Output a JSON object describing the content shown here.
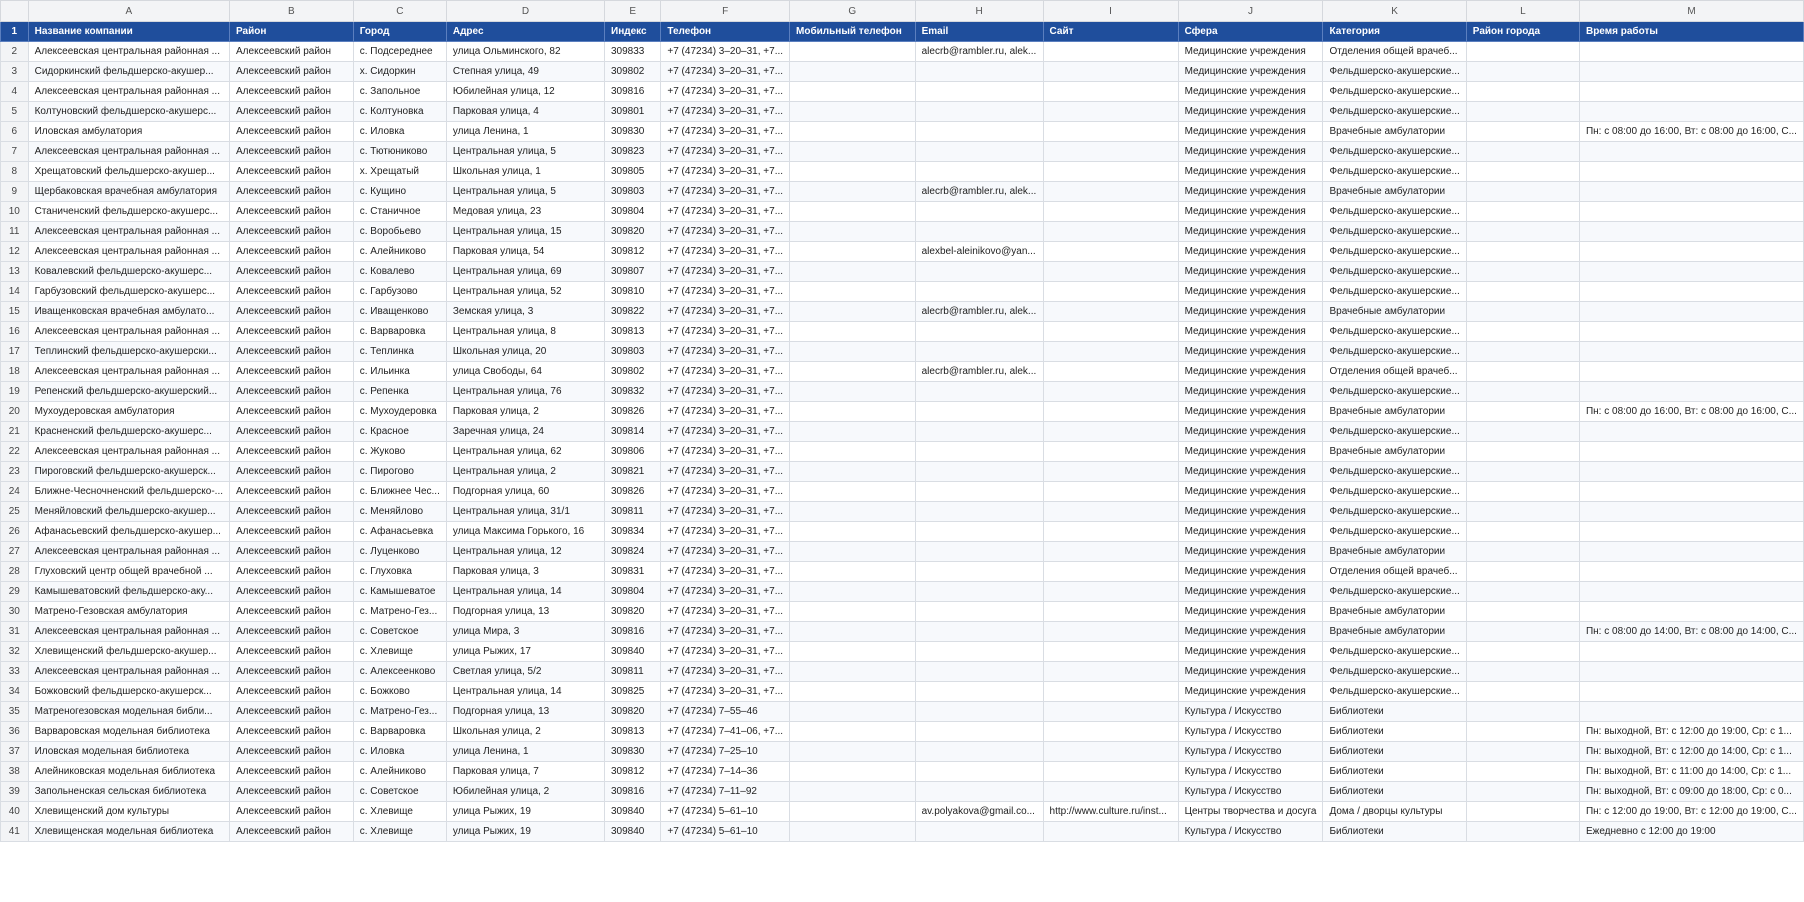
{
  "column_letters": [
    "A",
    "B",
    "C",
    "D",
    "E",
    "F",
    "G",
    "H",
    "I",
    "J",
    "K",
    "L",
    "M"
  ],
  "headers": {
    "row": "1",
    "cells": [
      "Название компании",
      "Район",
      "Город",
      "Адрес",
      "Индекс",
      "Телефон",
      "Мобильный телефон",
      "Email",
      "Сайт",
      "Сфера",
      "Категория",
      "Район города",
      "Время работы"
    ]
  },
  "rows": [
    {
      "num": "2",
      "cells": [
        "Алексеевская центральная районная ...",
        "Алексеевский район",
        "с. Подсереднее",
        "улица Ольминского, 82",
        "309833",
        "+7 (47234) 3–20–31, +7...",
        "",
        "alecrb@rambler.ru, alek...",
        "",
        "Медицинские учреждения",
        "Отделения общей врачеб...",
        "",
        ""
      ]
    },
    {
      "num": "3",
      "cells": [
        "Сидоркинский фельдшерско-акушер...",
        "Алексеевский район",
        "х. Сидоркин",
        "Степная улица, 49",
        "309802",
        "+7 (47234) 3–20–31, +7...",
        "",
        "",
        "",
        "Медицинские учреждения",
        "Фельдшерско-акушерские...",
        "",
        ""
      ]
    },
    {
      "num": "4",
      "cells": [
        "Алексеевская центральная районная ...",
        "Алексеевский район",
        "с. Запольное",
        "Юбилейная улица, 12",
        "309816",
        "+7 (47234) 3–20–31, +7...",
        "",
        "",
        "",
        "Медицинские учреждения",
        "Фельдшерско-акушерские...",
        "",
        ""
      ]
    },
    {
      "num": "5",
      "cells": [
        "Колтуновский фельдшерско-акушерс...",
        "Алексеевский район",
        "с. Колтуновка",
        "Парковая улица, 4",
        "309801",
        "+7 (47234) 3–20–31, +7...",
        "",
        "",
        "",
        "Медицинские учреждения",
        "Фельдшерско-акушерские...",
        "",
        ""
      ]
    },
    {
      "num": "6",
      "cells": [
        "Иловская амбулатория",
        "Алексеевский район",
        "с. Иловка",
        "улица Ленина, 1",
        "309830",
        "+7 (47234) 3–20–31, +7...",
        "",
        "",
        "",
        "Медицинские учреждения",
        "Врачебные амбулатории",
        "",
        "Пн: с 08:00 до 16:00, Вт: с 08:00 до 16:00, С..."
      ]
    },
    {
      "num": "7",
      "cells": [
        "Алексеевская центральная районная ...",
        "Алексеевский район",
        "с. Тютюниково",
        "Центральная улица, 5",
        "309823",
        "+7 (47234) 3–20–31, +7...",
        "",
        "",
        "",
        "Медицинские учреждения",
        "Фельдшерско-акушерские...",
        "",
        ""
      ]
    },
    {
      "num": "8",
      "cells": [
        "Хрещатовский фельдшерско-акушер...",
        "Алексеевский район",
        "х. Хрещатый",
        "Школьная улица, 1",
        "309805",
        "+7 (47234) 3–20–31, +7...",
        "",
        "",
        "",
        "Медицинские учреждения",
        "Фельдшерско-акушерские...",
        "",
        ""
      ]
    },
    {
      "num": "9",
      "cells": [
        "Щербаковская врачебная амбулатория",
        "Алексеевский район",
        "с. Кущино",
        "Центральная улица, 5",
        "309803",
        "+7 (47234) 3–20–31, +7...",
        "",
        "alecrb@rambler.ru, alek...",
        "",
        "Медицинские учреждения",
        "Врачебные амбулатории",
        "",
        ""
      ]
    },
    {
      "num": "10",
      "cells": [
        "Станиченский фельдшерско-акушерс...",
        "Алексеевский район",
        "с. Станичное",
        "Медовая улица, 23",
        "309804",
        "+7 (47234) 3–20–31, +7...",
        "",
        "",
        "",
        "Медицинские учреждения",
        "Фельдшерско-акушерские...",
        "",
        ""
      ]
    },
    {
      "num": "11",
      "cells": [
        "Алексеевская центральная районная ...",
        "Алексеевский район",
        "с. Воробьево",
        "Центральная улица, 15",
        "309820",
        "+7 (47234) 3–20–31, +7...",
        "",
        "",
        "",
        "Медицинские учреждения",
        "Фельдшерско-акушерские...",
        "",
        ""
      ]
    },
    {
      "num": "12",
      "cells": [
        "Алексеевская центральная районная ...",
        "Алексеевский район",
        "с. Алейниково",
        "Парковая улица, 54",
        "309812",
        "+7 (47234) 3–20–31, +7...",
        "",
        "alexbel-aleinikovo@yan...",
        "",
        "Медицинские учреждения",
        "Фельдшерско-акушерские...",
        "",
        ""
      ]
    },
    {
      "num": "13",
      "cells": [
        "Ковалевский фельдшерско-акушерс...",
        "Алексеевский район",
        "с. Ковалево",
        "Центральная улица, 69",
        "309807",
        "+7 (47234) 3–20–31, +7...",
        "",
        "",
        "",
        "Медицинские учреждения",
        "Фельдшерско-акушерские...",
        "",
        ""
      ]
    },
    {
      "num": "14",
      "cells": [
        "Гарбузовский фельдшерско-акушерс...",
        "Алексеевский район",
        "с. Гарбузово",
        "Центральная улица, 52",
        "309810",
        "+7 (47234) 3–20–31, +7...",
        "",
        "",
        "",
        "Медицинские учреждения",
        "Фельдшерско-акушерские...",
        "",
        ""
      ]
    },
    {
      "num": "15",
      "cells": [
        "Иващенковская врачебная амбулато...",
        "Алексеевский район",
        "с. Иващенково",
        "Земская улица, 3",
        "309822",
        "+7 (47234) 3–20–31, +7...",
        "",
        "alecrb@rambler.ru, alek...",
        "",
        "Медицинские учреждения",
        "Врачебные амбулатории",
        "",
        ""
      ]
    },
    {
      "num": "16",
      "cells": [
        "Алексеевская центральная районная ...",
        "Алексеевский район",
        "с. Варваровка",
        "Центральная улица, 8",
        "309813",
        "+7 (47234) 3–20–31, +7...",
        "",
        "",
        "",
        "Медицинские учреждения",
        "Фельдшерско-акушерские...",
        "",
        ""
      ]
    },
    {
      "num": "17",
      "cells": [
        "Теплинский фельдшерско-акушерски...",
        "Алексеевский район",
        "с. Теплинка",
        "Школьная улица, 20",
        "309803",
        "+7 (47234) 3–20–31, +7...",
        "",
        "",
        "",
        "Медицинские учреждения",
        "Фельдшерско-акушерские...",
        "",
        ""
      ]
    },
    {
      "num": "18",
      "cells": [
        "Алексеевская центральная районная ...",
        "Алексеевский район",
        "с. Ильинка",
        "улица Свободы, 64",
        "309802",
        "+7 (47234) 3–20–31, +7...",
        "",
        "alecrb@rambler.ru, alek...",
        "",
        "Медицинские учреждения",
        "Отделения общей врачеб...",
        "",
        ""
      ]
    },
    {
      "num": "19",
      "cells": [
        "Репенский фельдшерско-акушерский...",
        "Алексеевский район",
        "с. Репенка",
        "Центральная улица, 76",
        "309832",
        "+7 (47234) 3–20–31, +7...",
        "",
        "",
        "",
        "Медицинские учреждения",
        "Фельдшерско-акушерские...",
        "",
        ""
      ]
    },
    {
      "num": "20",
      "cells": [
        "Мухоудеровская амбулатория",
        "Алексеевский район",
        "с. Мухоудеровка",
        "Парковая улица, 2",
        "309826",
        "+7 (47234) 3–20–31, +7...",
        "",
        "",
        "",
        "Медицинские учреждения",
        "Врачебные амбулатории",
        "",
        "Пн: с 08:00 до 16:00, Вт: с 08:00 до 16:00, С..."
      ]
    },
    {
      "num": "21",
      "cells": [
        "Красненский фельдшерско-акушерс...",
        "Алексеевский район",
        "с. Красное",
        "Заречная улица, 24",
        "309814",
        "+7 (47234) 3–20–31, +7...",
        "",
        "",
        "",
        "Медицинские учреждения",
        "Фельдшерско-акушерские...",
        "",
        ""
      ]
    },
    {
      "num": "22",
      "cells": [
        "Алексеевская центральная районная ...",
        "Алексеевский район",
        "с. Жуково",
        "Центральная улица, 62",
        "309806",
        "+7 (47234) 3–20–31, +7...",
        "",
        "",
        "",
        "Медицинские учреждения",
        "Врачебные амбулатории",
        "",
        ""
      ]
    },
    {
      "num": "23",
      "cells": [
        "Пироговский фельдшерско-акушерск...",
        "Алексеевский район",
        "с. Пирогово",
        "Центральная улица, 2",
        "309821",
        "+7 (47234) 3–20–31, +7...",
        "",
        "",
        "",
        "Медицинские учреждения",
        "Фельдшерско-акушерские...",
        "",
        ""
      ]
    },
    {
      "num": "24",
      "cells": [
        "Ближне-Чесночненский фельдшерско-...",
        "Алексеевский район",
        "с. Ближнее Чес...",
        "Подгорная улица, 60",
        "309826",
        "+7 (47234) 3–20–31, +7...",
        "",
        "",
        "",
        "Медицинские учреждения",
        "Фельдшерско-акушерские...",
        "",
        ""
      ]
    },
    {
      "num": "25",
      "cells": [
        "Меняйловский фельдшерско-акушер...",
        "Алексеевский район",
        "с. Меняйлово",
        "Центральная улица, 31/1",
        "309811",
        "+7 (47234) 3–20–31, +7...",
        "",
        "",
        "",
        "Медицинские учреждения",
        "Фельдшерско-акушерские...",
        "",
        ""
      ]
    },
    {
      "num": "26",
      "cells": [
        "Афанасьевский фельдшерско-акушер...",
        "Алексеевский район",
        "с. Афанасьевка",
        "улица Максима Горького, 16",
        "309834",
        "+7 (47234) 3–20–31, +7...",
        "",
        "",
        "",
        "Медицинские учреждения",
        "Фельдшерско-акушерские...",
        "",
        ""
      ]
    },
    {
      "num": "27",
      "cells": [
        "Алексеевская центральная районная ...",
        "Алексеевский район",
        "с. Луценково",
        "Центральная улица, 12",
        "309824",
        "+7 (47234) 3–20–31, +7...",
        "",
        "",
        "",
        "Медицинские учреждения",
        "Врачебные амбулатории",
        "",
        ""
      ]
    },
    {
      "num": "28",
      "cells": [
        "Глуховский центр общей врачебной ...",
        "Алексеевский район",
        "с. Глуховка",
        "Парковая улица, 3",
        "309831",
        "+7 (47234) 3–20–31, +7...",
        "",
        "",
        "",
        "Медицинские учреждения",
        "Отделения общей врачеб...",
        "",
        ""
      ]
    },
    {
      "num": "29",
      "cells": [
        "Камышеватовский фельдшерско-аку...",
        "Алексеевский район",
        "с. Камышеватое",
        "Центральная улица, 14",
        "309804",
        "+7 (47234) 3–20–31, +7...",
        "",
        "",
        "",
        "Медицинские учреждения",
        "Фельдшерско-акушерские...",
        "",
        ""
      ]
    },
    {
      "num": "30",
      "cells": [
        "Матрено-Гезовская амбулатория",
        "Алексеевский район",
        "с. Матрено-Гез...",
        "Подгорная улица, 13",
        "309820",
        "+7 (47234) 3–20–31, +7...",
        "",
        "",
        "",
        "Медицинские учреждения",
        "Врачебные амбулатории",
        "",
        ""
      ]
    },
    {
      "num": "31",
      "cells": [
        "Алексеевская центральная районная ...",
        "Алексеевский район",
        "с. Советское",
        "улица Мира, 3",
        "309816",
        "+7 (47234) 3–20–31, +7...",
        "",
        "",
        "",
        "Медицинские учреждения",
        "Врачебные амбулатории",
        "",
        "Пн: с 08:00 до 14:00, Вт: с 08:00 до 14:00, С..."
      ]
    },
    {
      "num": "32",
      "cells": [
        "Хлевищенский фельдшерско-акушер...",
        "Алексеевский район",
        "с. Хлевище",
        "улица Рыжих, 17",
        "309840",
        "+7 (47234) 3–20–31, +7...",
        "",
        "",
        "",
        "Медицинские учреждения",
        "Фельдшерско-акушерские...",
        "",
        ""
      ]
    },
    {
      "num": "33",
      "cells": [
        "Алексеевская центральная районная ...",
        "Алексеевский район",
        "с. Алексеенково",
        "Светлая улица, 5/2",
        "309811",
        "+7 (47234) 3–20–31, +7...",
        "",
        "",
        "",
        "Медицинские учреждения",
        "Фельдшерско-акушерские...",
        "",
        ""
      ]
    },
    {
      "num": "34",
      "cells": [
        "Божковский фельдшерско-акушерск...",
        "Алексеевский район",
        "с. Божково",
        "Центральная улица, 14",
        "309825",
        "+7 (47234) 3–20–31, +7...",
        "",
        "",
        "",
        "Медицинские учреждения",
        "Фельдшерско-акушерские...",
        "",
        ""
      ]
    },
    {
      "num": "35",
      "cells": [
        "Матреногезовская модельная библи...",
        "Алексеевский район",
        "с. Матрено-Гез...",
        "Подгорная улица, 13",
        "309820",
        "+7 (47234) 7–55–46",
        "",
        "",
        "",
        "Культура / Искусство",
        "Библиотеки",
        "",
        ""
      ]
    },
    {
      "num": "36",
      "cells": [
        "Варваровская модельная библиотека",
        "Алексеевский район",
        "с. Варваровка",
        "Школьная улица, 2",
        "309813",
        "+7 (47234) 7–41–06, +7...",
        "",
        "",
        "",
        "Культура / Искусство",
        "Библиотеки",
        "",
        "Пн: выходной, Вт: с 12:00 до 19:00, Ср: с 1..."
      ]
    },
    {
      "num": "37",
      "cells": [
        "Иловская модельная библиотека",
        "Алексеевский район",
        "с. Иловка",
        "улица Ленина, 1",
        "309830",
        "+7 (47234) 7–25–10",
        "",
        "",
        "",
        "Культура / Искусство",
        "Библиотеки",
        "",
        "Пн: выходной, Вт: с 12:00 до 14:00, Ср: с 1..."
      ]
    },
    {
      "num": "38",
      "cells": [
        "Алейниковская модельная библиотека",
        "Алексеевский район",
        "с. Алейниково",
        "Парковая улица, 7",
        "309812",
        "+7 (47234) 7–14–36",
        "",
        "",
        "",
        "Культура / Искусство",
        "Библиотеки",
        "",
        "Пн: выходной, Вт: с 11:00 до 14:00, Ср: с 1..."
      ]
    },
    {
      "num": "39",
      "cells": [
        "Запольненская сельская библиотека",
        "Алексеевский район",
        "с. Советское",
        "Юбилейная улица, 2",
        "309816",
        "+7 (47234) 7–11–92",
        "",
        "",
        "",
        "Культура / Искусство",
        "Библиотеки",
        "",
        "Пн: выходной, Вт: с 09:00 до 18:00, Ср: с 0..."
      ]
    },
    {
      "num": "40",
      "cells": [
        "Хлевищенский дом культуры",
        "Алексеевский район",
        "с. Хлевище",
        "улица Рыжих, 19",
        "309840",
        "+7 (47234) 5–61–10",
        "",
        "av.polyakova@gmail.co...",
        "http://www.culture.ru/inst...",
        "Центры творчества и досуга",
        "Дома / дворцы культуры",
        "",
        "Пн: с 12:00 до 19:00, Вт: с 12:00 до 19:00, С..."
      ]
    },
    {
      "num": "41",
      "cells": [
        "Хлевищенская модельная библиотека",
        "Алексеевский район",
        "с. Хлевище",
        "улица Рыжих, 19",
        "309840",
        "+7 (47234) 5–61–10",
        "",
        "",
        "",
        "Культура / Искусство",
        "Библиотеки",
        "",
        "Ежедневно с 12:00 до 19:00"
      ]
    }
  ]
}
